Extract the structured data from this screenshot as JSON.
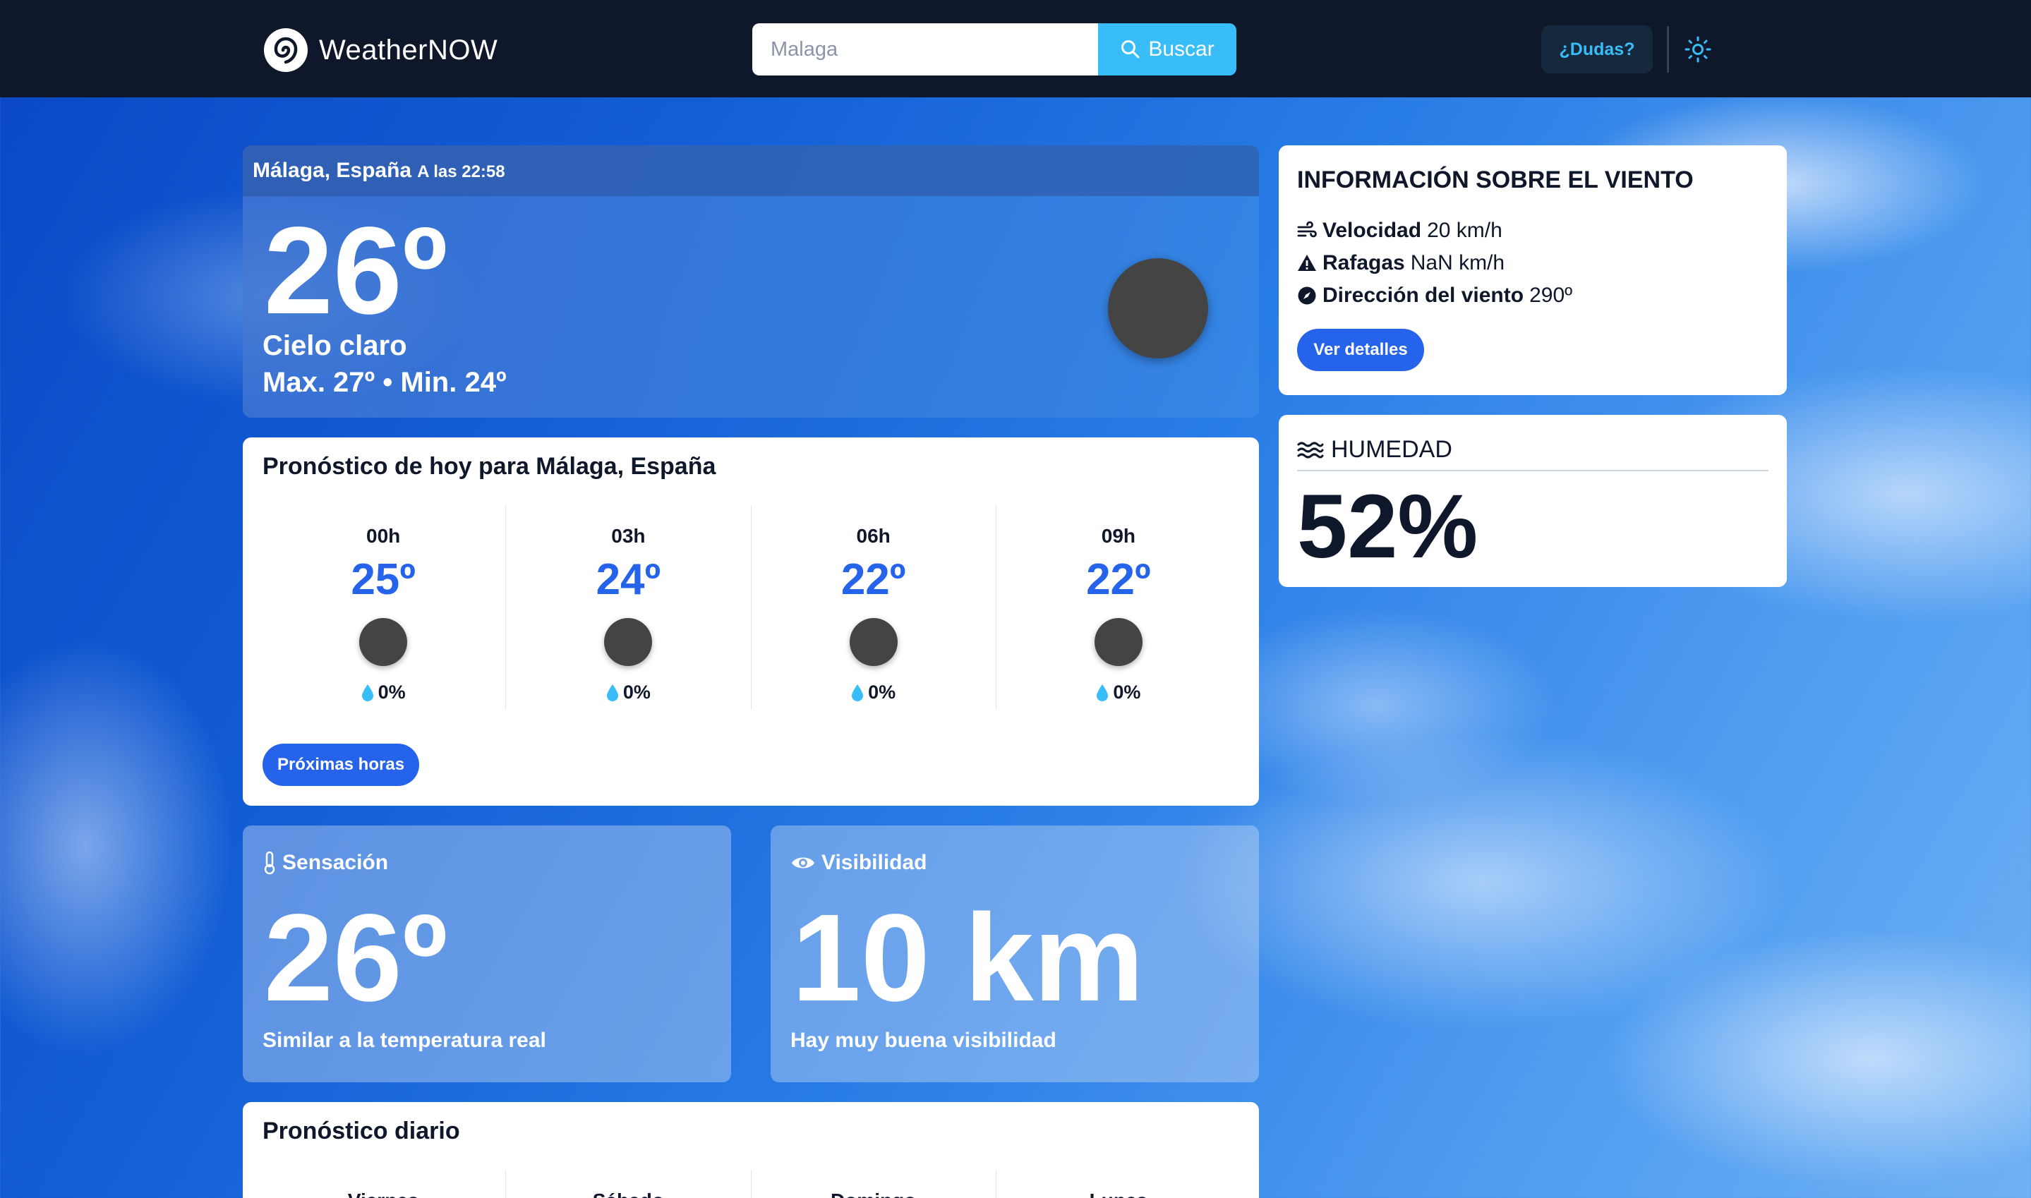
{
  "header": {
    "brand": "WeatherNOW",
    "search_value": "",
    "search_placeholder": "Malaga",
    "search_button": "Buscar",
    "help_button": "¿Dudas?"
  },
  "current": {
    "location": "Málaga, España",
    "time": "A las 22:58",
    "temperature": "26º",
    "description": "Cielo claro",
    "minmax": "Max. 27º • Min. 24º"
  },
  "hourly": {
    "title": "Pronóstico de hoy para Málaga, España",
    "items": [
      {
        "hour": "00h",
        "temp": "25º",
        "rain": "0%"
      },
      {
        "hour": "03h",
        "temp": "24º",
        "rain": "0%"
      },
      {
        "hour": "06h",
        "temp": "22º",
        "rain": "0%"
      },
      {
        "hour": "09h",
        "temp": "22º",
        "rain": "0%"
      }
    ],
    "button": "Próximas horas"
  },
  "feels": {
    "label": "Sensación",
    "value": "26º",
    "note": "Similar a la temperatura real"
  },
  "visibility": {
    "label": "Visibilidad",
    "value": "10 km",
    "note": "Hay muy buena visibilidad"
  },
  "daily": {
    "title": "Pronóstico diario",
    "days": [
      "Viernes",
      "Sábado",
      "Domingo",
      "Lunes"
    ]
  },
  "wind": {
    "title": "INFORMACIÓN SOBRE EL VIENTO",
    "speed_label": "Velocidad",
    "speed_value": "20 km/h",
    "gust_label": "Rafagas",
    "gust_value": "NaN km/h",
    "dir_label": "Dirección del viento",
    "dir_value": "290º",
    "button": "Ver detalles"
  },
  "humidity": {
    "title": "HUMEDAD",
    "value": "52%"
  },
  "colors": {
    "header_bg": "#0f172a",
    "accent": "#2563eb",
    "search_button": "#38bdf8",
    "text_dark": "#0f172a"
  }
}
